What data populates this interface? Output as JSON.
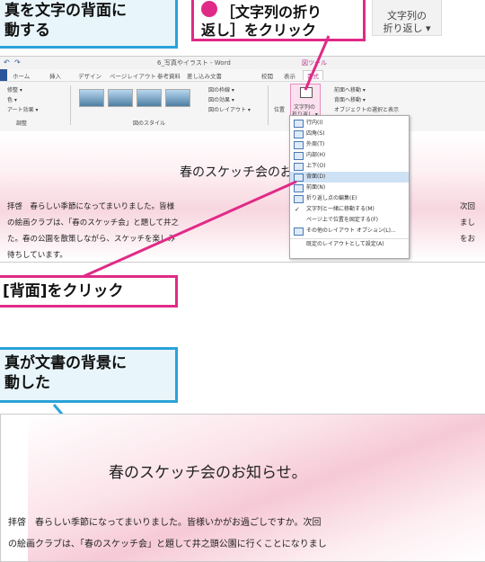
{
  "callouts": {
    "top_left_line1": "真を文字の背面に",
    "top_left_line2": "動する",
    "step_number": "",
    "top_mid_line1": "［文字列の折り",
    "top_mid_line2": "返し］をクリック",
    "top_right_line1": "文字列の",
    "top_right_line2": "折り返し ▾",
    "mid_pink": "[背面]をクリック",
    "mid_cyan_line1": "真が文書の背景に",
    "mid_cyan_line2": "動した"
  },
  "window": {
    "title": "6_写真やイラスト - Word",
    "context_tab": "図ツール",
    "tabs": [
      "ホーム",
      "挿入",
      "デザイン",
      "ページレイアウト",
      "参考資料",
      "差し込み文書",
      "校閲",
      "表示",
      "書式"
    ],
    "ribbon": {
      "adjust_items": [
        "修整 ▾",
        "色 ▾",
        "アート効果 ▾"
      ],
      "adjust_group": "調整",
      "style_group": "図のスタイル",
      "style_options": [
        "図の枠線 ▾",
        "図の効果 ▾",
        "図のレイアウト ▾"
      ],
      "position_label": "位置",
      "wrap_label_1": "文字列の",
      "wrap_label_2": "折り返し ▾",
      "arrange_items": [
        "前面へ移動 ▾",
        "背面へ移動 ▾",
        "オブジェクトの選択と表示"
      ]
    },
    "menu_items": [
      "行内(I)",
      "四角(S)",
      "外周(T)",
      "内部(H)",
      "上下(O)",
      "背面(D)",
      "前面(N)",
      "折り返し点の編集(E)",
      "文字列と一緒に移動する(M)",
      "ページ上で位置を固定する(F)",
      "その他のレイアウト オプション(L)...",
      "既定のレイアウトとして設定(A)"
    ],
    "doc": {
      "title": "春のスケッチ会のお",
      "line1": "拝啓　春らしい季節になってまいりました。皆様",
      "line1_end": "次回",
      "line2": "の絵画クラブは、「春のスケッチ会」と題して井之",
      "line2_end": "まし",
      "line3": "た。春の公園を散策しながら、スケッチを楽しみ",
      "line3_end": "をお",
      "line4": "待ちしています。"
    }
  },
  "result_doc": {
    "title": "春のスケッチ会のお知らせ。",
    "line1": "拝啓　春らしい季節になってまいりました。皆様いかがお過ごしですか。次回",
    "line2": "の絵画クラブは、「春のスケッチ会」と題して井之頭公園に行くことになりまし"
  }
}
